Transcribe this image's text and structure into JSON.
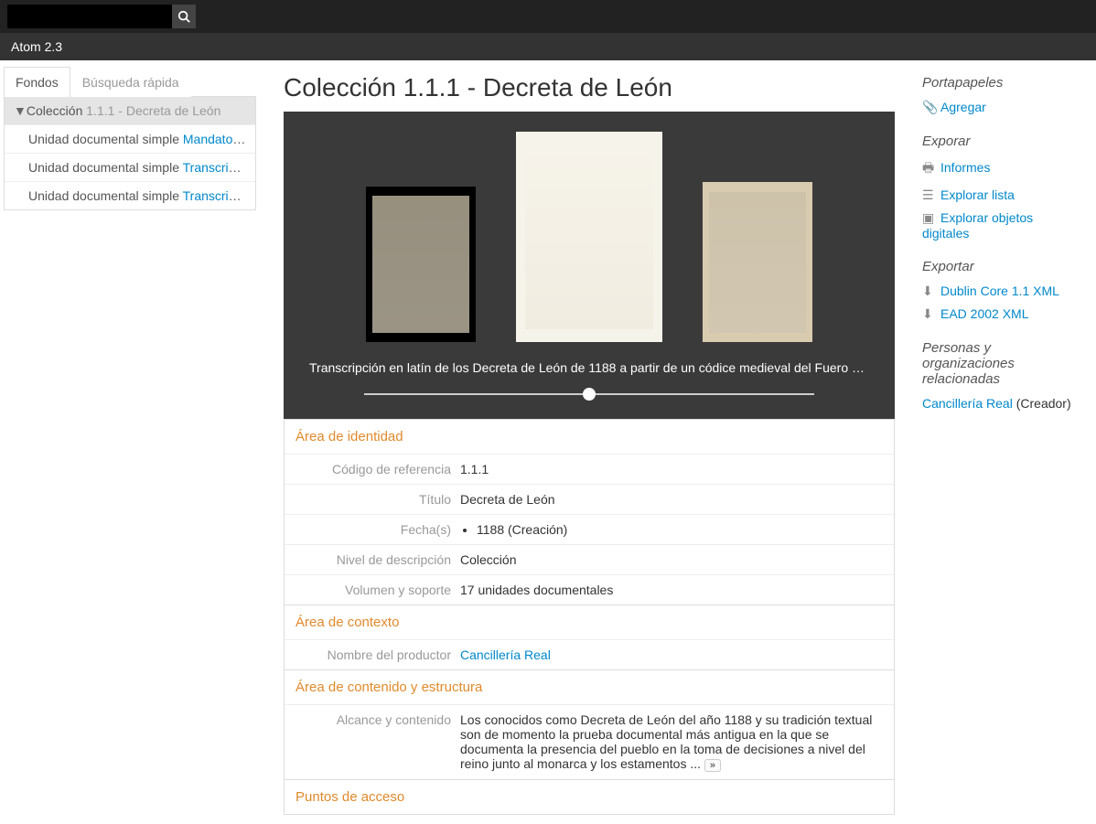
{
  "brand": "Atom 2.3",
  "search": {
    "placeholder": ""
  },
  "left": {
    "tabs": {
      "fondos": "Fondos",
      "quick": "Búsqueda rápida"
    },
    "tree": [
      {
        "marker": "▼",
        "level": "Colección",
        "title": "1.1.1 - Decreta de León",
        "selected": true
      },
      {
        "marker": "",
        "level": "Unidad documental simple",
        "title": "Mandato d...",
        "selected": false
      },
      {
        "marker": "",
        "level": "Unidad documental simple",
        "title": "Transcripci...",
        "selected": false
      },
      {
        "marker": "",
        "level": "Unidad documental simple",
        "title": "Transcripci...",
        "selected": false
      }
    ]
  },
  "page_title": "Colección 1.1.1 - Decreta de León",
  "viewer": {
    "caption": "Transcripción en latín de los Decreta de León de 1188 a partir de un códice medieval del Fuero Ju..."
  },
  "sections": {
    "identidad": {
      "title": "Área de identidad",
      "rows": {
        "codigo_label": "Código de referencia",
        "codigo_value": "1.1.1",
        "titulo_label": "Título",
        "titulo_value": "Decreta de León",
        "fechas_label": "Fecha(s)",
        "fechas_value": "1188 (Creación)",
        "nivel_label": "Nivel de descripción",
        "nivel_value": "Colección",
        "vol_label": "Volumen y soporte",
        "vol_value": "17 unidades documentales"
      }
    },
    "contexto": {
      "title": "Área de contexto",
      "rows": {
        "productor_label": "Nombre del productor",
        "productor_value": "Cancillería Real"
      }
    },
    "contenido": {
      "title": "Área de contenido y estructura",
      "rows": {
        "alcance_label": "Alcance y contenido",
        "alcance_value": "Los conocidos como Decreta de León del año 1188 y su tradición textual son de momento la prueba documental más antigua en la que se documenta la presencia del pueblo en la toma de decisiones a nivel del reino junto al monarca y los estamentos ... ",
        "expand": "»"
      }
    },
    "acceso": {
      "title": "Puntos de acceso"
    }
  },
  "right": {
    "clipboard": {
      "title": "Portapapeles",
      "add": "Agregar"
    },
    "explore": {
      "title": "Exporar",
      "reports": "Informes",
      "browse_list": "Explorar lista",
      "browse_digital": "Explorar objetos digitales"
    },
    "export": {
      "title": "Exportar",
      "dc": "Dublin Core 1.1 XML",
      "ead": "EAD 2002 XML"
    },
    "related": {
      "title": "Personas y organizaciones relacionadas",
      "chancery": "Cancillería Real",
      "chancery_role": " (Creador)"
    }
  }
}
